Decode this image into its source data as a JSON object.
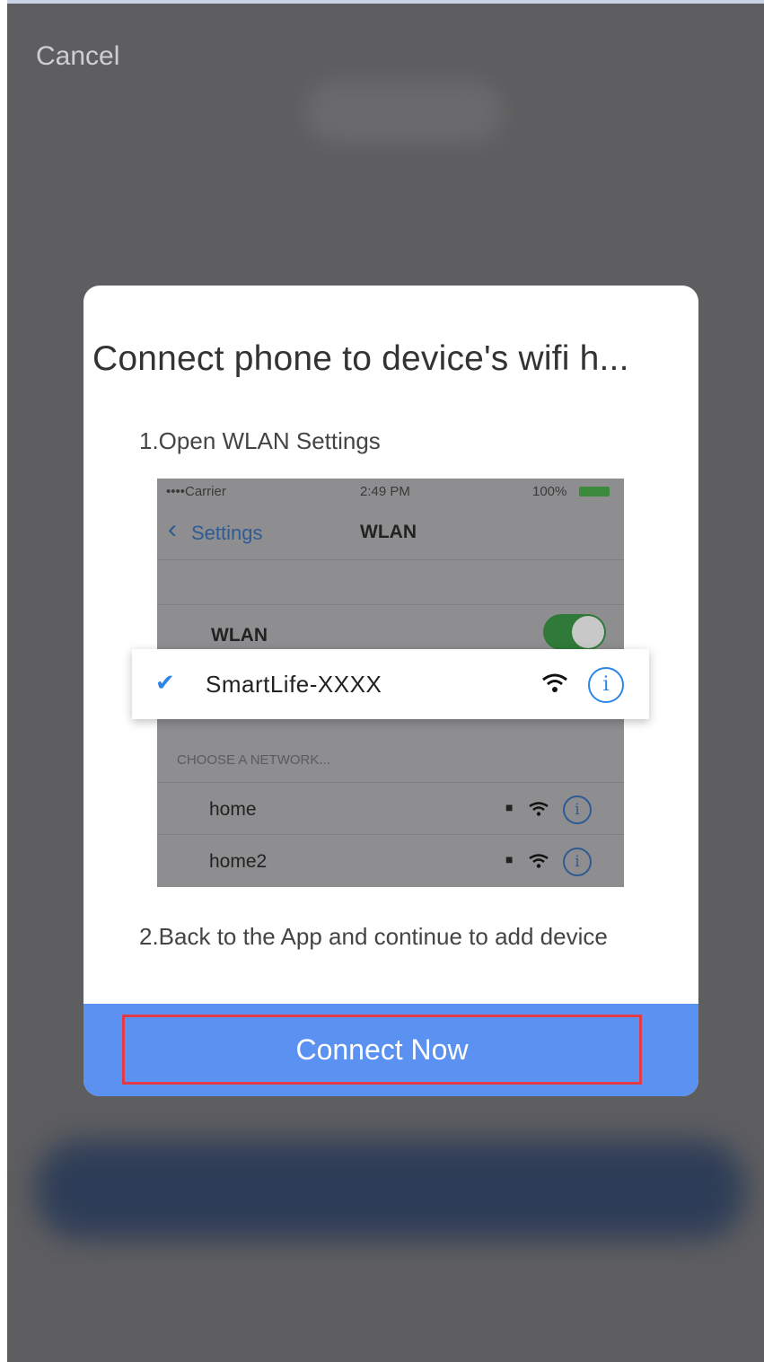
{
  "header": {
    "cancel_label": "Cancel"
  },
  "modal": {
    "title": "Connect phone to device's wifi h...",
    "step1": "1.Open WLAN Settings",
    "step2": "2.Back to the App and continue to add device",
    "connect_label": "Connect Now"
  },
  "illustration": {
    "status_carrier": "••••Carrier",
    "status_time": "2:49 PM",
    "status_battery": "100%",
    "back_label": "Settings",
    "nav_title": "WLAN",
    "wlan_label": "WLAN",
    "selected_network": "SmartLife-XXXX",
    "section_header": "CHOOSE A NETWORK...",
    "networks": [
      "home",
      "home2"
    ]
  },
  "colors": {
    "accent": "#5b92f2",
    "highlight_border": "#e13b45",
    "check": "#2b86e8"
  },
  "icons": [
    "check-icon",
    "wifi-icon",
    "info-icon",
    "lock-icon",
    "chevron-left-icon"
  ]
}
